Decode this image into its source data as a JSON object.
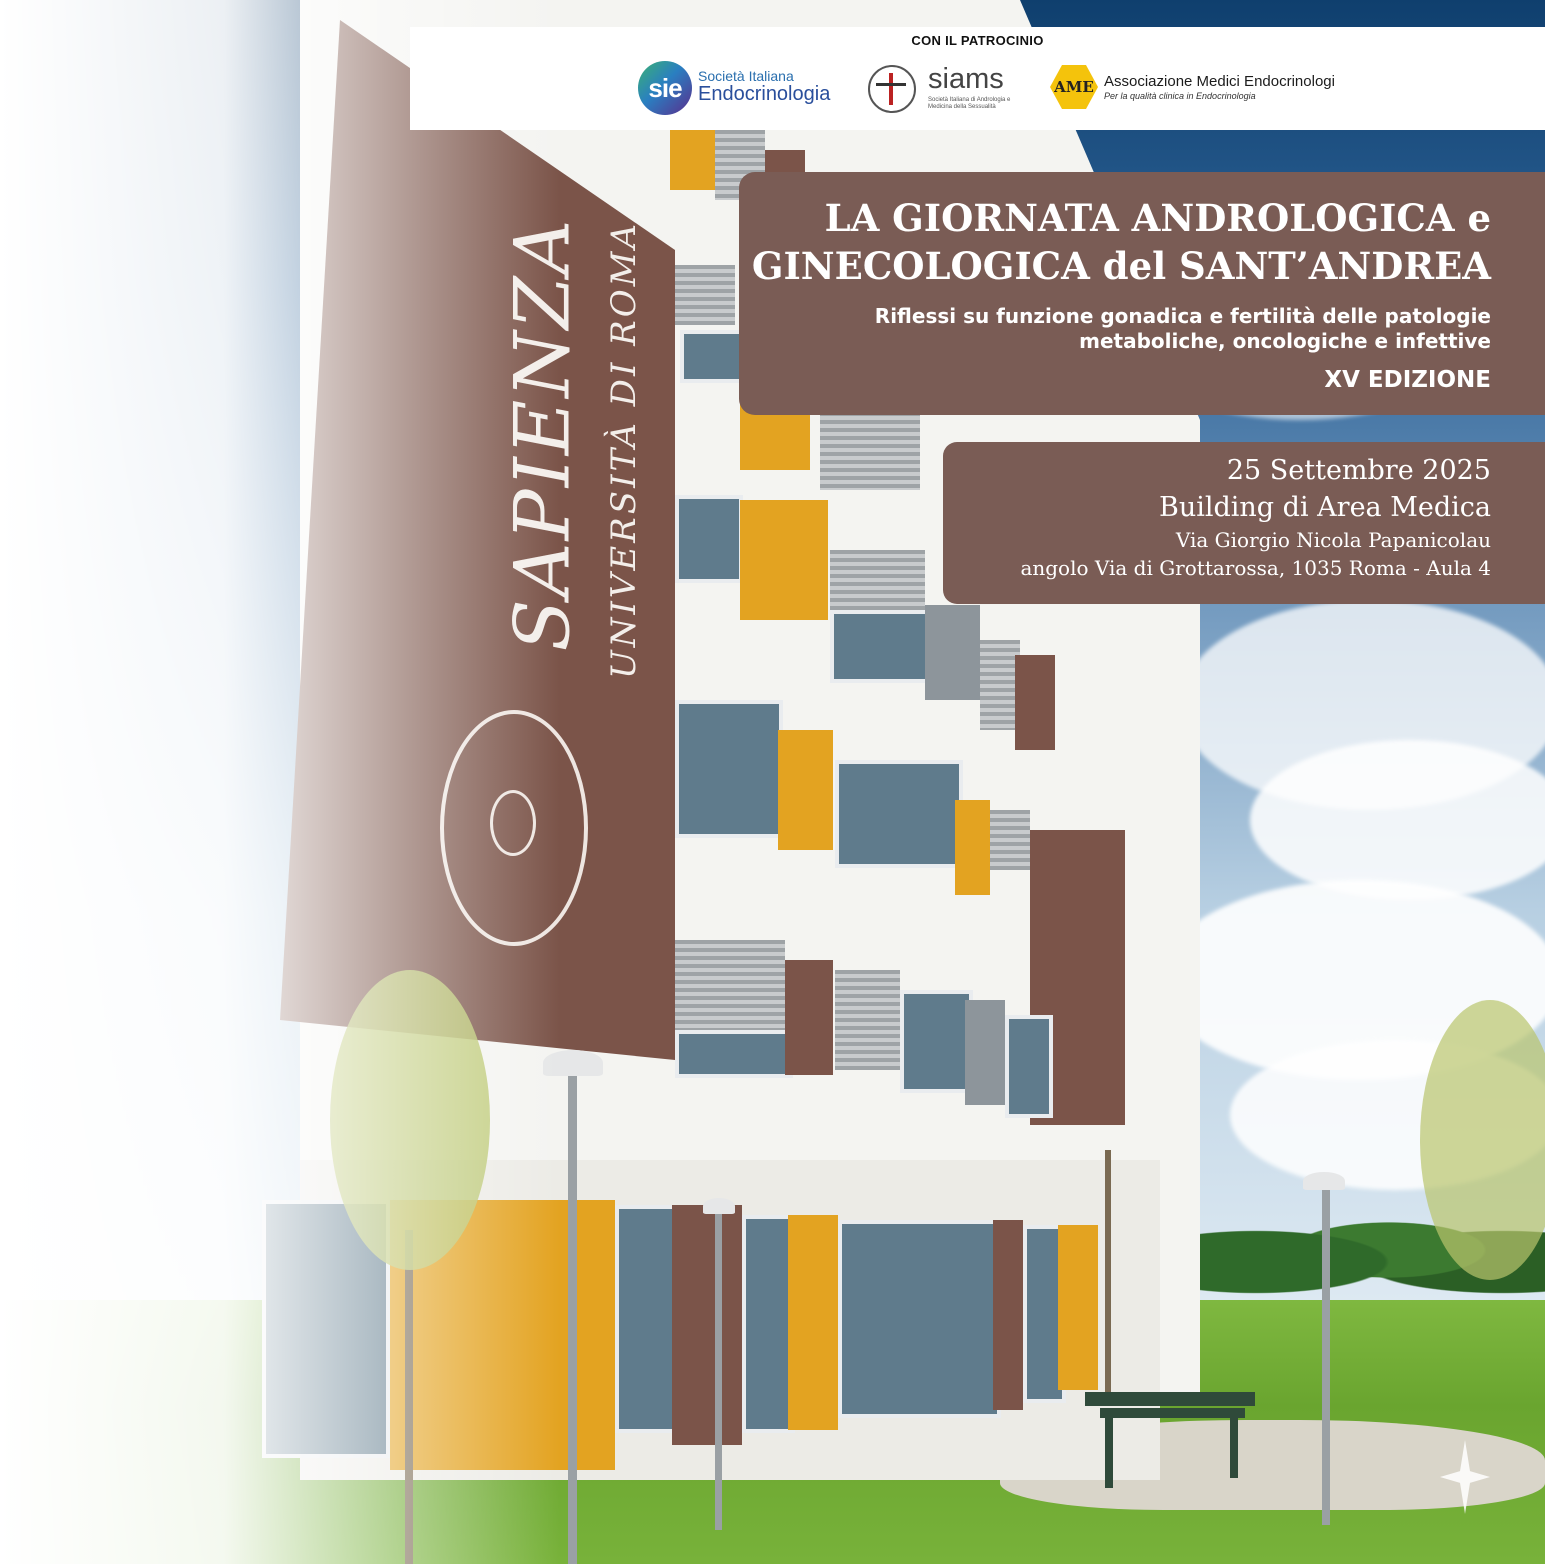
{
  "patronage": {
    "title": "CON IL PATROCINIO",
    "sie": {
      "badge": "sie",
      "line1": "Società Italiana",
      "line2": "Endocrinologia"
    },
    "siams": {
      "name": "siams",
      "subtitle": "Società Italiana di Andrologia e Medicina della Sessualità",
      "icon": "vitruvian-figure-icon"
    },
    "ame": {
      "badge": "AME",
      "name": "Associazione Medici Endocrinologi",
      "tagline": "Per la qualità clinica in Endocrinologia"
    }
  },
  "event": {
    "title_line1": "LA GIORNATA ANDROLOGICA e",
    "title_line2": "GINECOLOGICA del SANT’ANDREA",
    "subtitle_line1": "Riflessi su funzione gonadica e fertilità delle patologie",
    "subtitle_line2": "metaboliche, oncologiche e infettive",
    "edition": "XV EDIZIONE",
    "date": "25 Settembre 2025",
    "venue": "Building di Area Medica",
    "address_line1": "Via Giorgio Nicola Papanicolau",
    "address_line2": "angolo Via di Grottarossa, 1035 Roma - Aula 4"
  },
  "building_banner": {
    "main": "SAPIENZA",
    "sub": "UNIVERSITÀ DI ROMA"
  },
  "colors": {
    "box_brown": "#7a5c55",
    "banner_brown": "#7b5449",
    "panel_yellow": "#e3a321",
    "sky_top": "#0f3f6e"
  }
}
